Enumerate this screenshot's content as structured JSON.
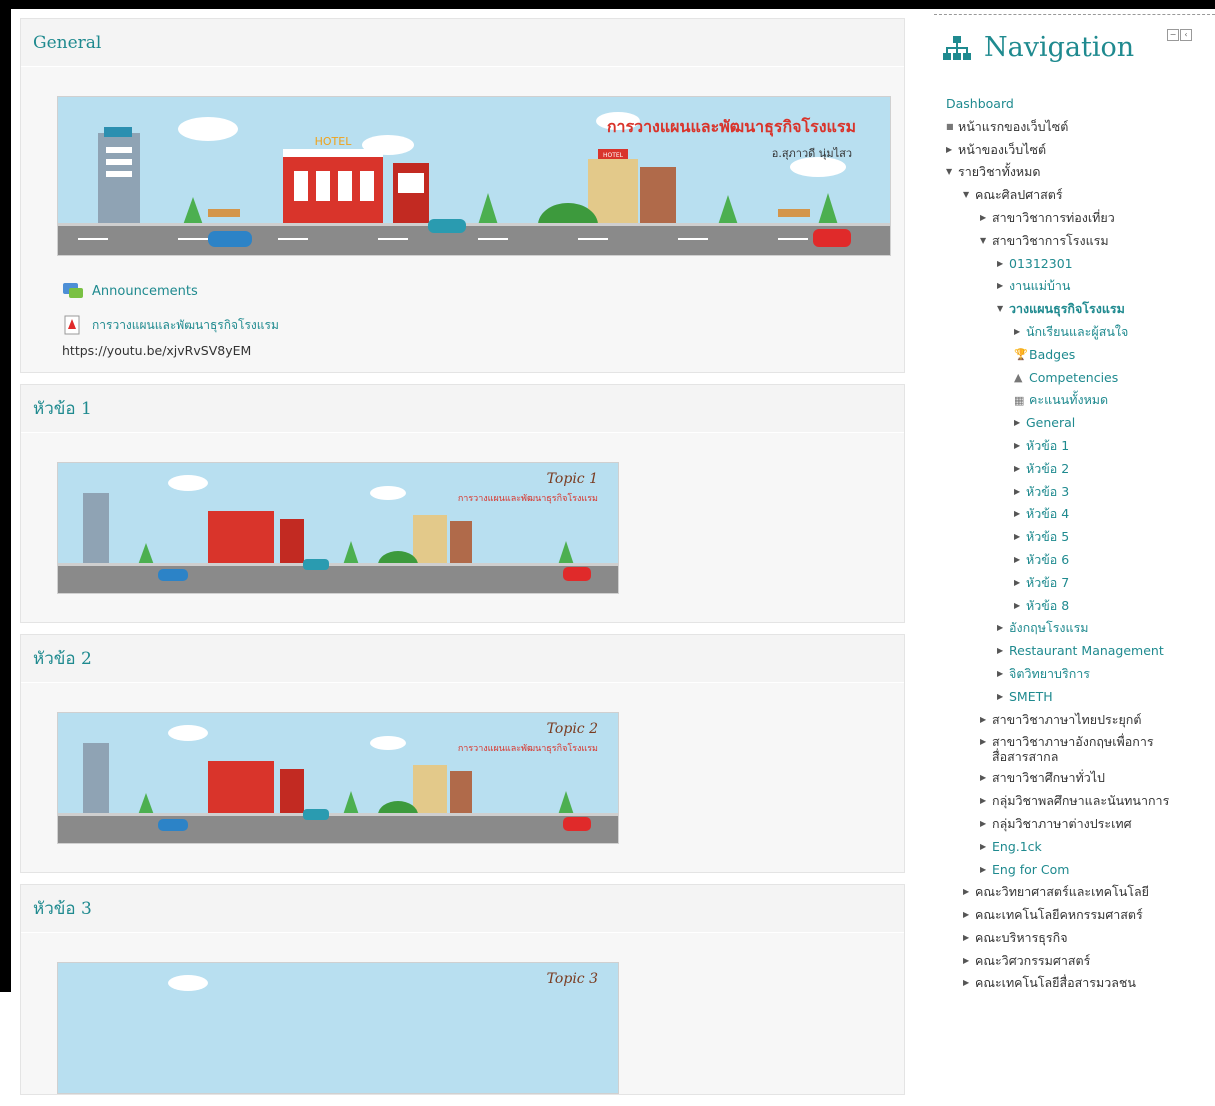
{
  "sections": [
    {
      "title": "General",
      "banner": {
        "title": "การวางแผนและพัฒนาธุรกิจโรงแรม",
        "subtitle": "อ.สุภาวดี นุ่มไสว",
        "hotel_label": "HOTEL",
        "hotel_sign": "HOTEL"
      },
      "activities": [
        {
          "icon": "forum-icon",
          "label": "Announcements"
        },
        {
          "icon": "pdf-icon",
          "label": "การวางแผนและพัฒนาธุรกิจโรงแรม"
        }
      ],
      "url_text": "https://youtu.be/xjvRvSV8yEM"
    },
    {
      "title": "หัวข้อ 1",
      "banner": {
        "topic": "Topic 1",
        "caption": "การวางแผนและพัฒนาธุรกิจโรงแรม"
      }
    },
    {
      "title": "หัวข้อ 2",
      "banner": {
        "topic": "Topic 2",
        "caption": "การวางแผนและพัฒนาธุรกิจโรงแรม"
      }
    },
    {
      "title": "หัวข้อ 3",
      "banner": {
        "topic": "Topic 3"
      }
    }
  ],
  "navigation": {
    "title": "Navigation",
    "icon": "sitemap-icon",
    "dashboard": "Dashboard",
    "items": [
      {
        "label": "หน้าแรกของเว็บไซต์",
        "marker": "bullet"
      },
      {
        "label": "หน้าของเว็บไซต์",
        "marker": "collapsed"
      },
      {
        "label": "รายวิชาทั้งหมด",
        "marker": "expanded"
      },
      {
        "label": "คณะศิลปศาสตร์",
        "marker": "expanded"
      },
      {
        "label": "สาขาวิชาการท่องเที่ยว",
        "marker": "collapsed"
      },
      {
        "label": "สาขาวิชาการโรงแรม",
        "marker": "expanded"
      },
      {
        "label": "01312301",
        "marker": "collapsed"
      },
      {
        "label": "งานแม่บ้าน",
        "marker": "collapsed"
      },
      {
        "label": "วางแผนธุรกิจโรงแรม",
        "marker": "expanded"
      },
      {
        "label": "นักเรียนและผู้สนใจ",
        "marker": "collapsed"
      },
      {
        "label": "Badges",
        "marker": "badge-icon"
      },
      {
        "label": "Competencies",
        "marker": "competency-icon"
      },
      {
        "label": "คะแนนทั้งหมด",
        "marker": "grades-icon"
      },
      {
        "label": "General",
        "marker": "collapsed"
      },
      {
        "label": "หัวข้อ 1",
        "marker": "collapsed"
      },
      {
        "label": "หัวข้อ 2",
        "marker": "collapsed"
      },
      {
        "label": "หัวข้อ 3",
        "marker": "collapsed"
      },
      {
        "label": "หัวข้อ 4",
        "marker": "collapsed"
      },
      {
        "label": "หัวข้อ 5",
        "marker": "collapsed"
      },
      {
        "label": "หัวข้อ 6",
        "marker": "collapsed"
      },
      {
        "label": "หัวข้อ 7",
        "marker": "collapsed"
      },
      {
        "label": "หัวข้อ 8",
        "marker": "collapsed"
      },
      {
        "label": "อังกฤษโรงแรม",
        "marker": "collapsed"
      },
      {
        "label": "Restaurant Management",
        "marker": "collapsed"
      },
      {
        "label": "จิตวิทยาบริการ",
        "marker": "collapsed"
      },
      {
        "label": "SMETH",
        "marker": "collapsed"
      },
      {
        "label": "สาขาวิชาภาษาไทยประยุกต์",
        "marker": "collapsed"
      },
      {
        "label": "สาขาวิชาภาษาอังกฤษเพื่อการ",
        "label2": "สื่อสารสากล",
        "marker": "collapsed"
      },
      {
        "label": "สาขาวิชาศึกษาทั่วไป",
        "marker": "collapsed"
      },
      {
        "label": "กลุ่มวิชาพลศึกษาและนันทนาการ",
        "marker": "collapsed"
      },
      {
        "label": "กลุ่มวิชาภาษาต่างประเทศ",
        "marker": "collapsed"
      },
      {
        "label": "Eng.1ck",
        "marker": "collapsed"
      },
      {
        "label": "Eng for Com",
        "marker": "collapsed"
      },
      {
        "label": "คณะวิทยาศาสตร์และเทคโนโลยี",
        "marker": "collapsed"
      },
      {
        "label": "คณะเทคโนโลยีคหกรรมศาสตร์",
        "marker": "collapsed"
      },
      {
        "label": "คณะบริหารธุรกิจ",
        "marker": "collapsed"
      },
      {
        "label": "คณะวิศวกรรมศาสตร์",
        "marker": "collapsed"
      },
      {
        "label": "คณะเทคโนโลยีสื่อสารมวลชน",
        "marker": "collapsed"
      }
    ]
  },
  "colors": {
    "accent": "#1f8a8f",
    "section_bg": "#f4f4f4",
    "sky": "#b8dff0",
    "road": "#8a8a8a",
    "hotel_red": "#d9342b"
  }
}
